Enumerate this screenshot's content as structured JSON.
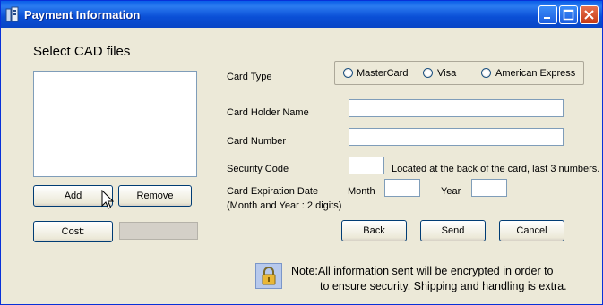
{
  "window": {
    "title": "Payment Information"
  },
  "files": {
    "label": "Select CAD files",
    "add_label": "Add",
    "remove_label": "Remove"
  },
  "cost": {
    "button_label": "Cost:",
    "value": ""
  },
  "card_type": {
    "label": "Card Type",
    "options": [
      "MasterCard",
      "Visa",
      "American Express"
    ]
  },
  "card_holder": {
    "label": "Card Holder Name",
    "value": ""
  },
  "card_number": {
    "label": "Card Number",
    "value": ""
  },
  "security_code": {
    "label": "Security Code",
    "value": "",
    "hint": "Located at the back of the card, last 3 numbers."
  },
  "expiration": {
    "label": "Card Expiration Date",
    "sublabel": "(Month and Year : 2 digits)",
    "month_label": "Month",
    "month_value": "",
    "year_label": "Year",
    "year_value": ""
  },
  "actions": {
    "back": "Back",
    "send": "Send",
    "cancel": "Cancel"
  },
  "note": {
    "line1": "Note:All information sent will be encrypted in order to",
    "line2": "to ensure security. Shipping and handling is extra."
  },
  "icons": [
    "app-icon",
    "minimize-icon",
    "maximize-icon",
    "close-icon",
    "lock-icon",
    "mouse-cursor-icon"
  ]
}
